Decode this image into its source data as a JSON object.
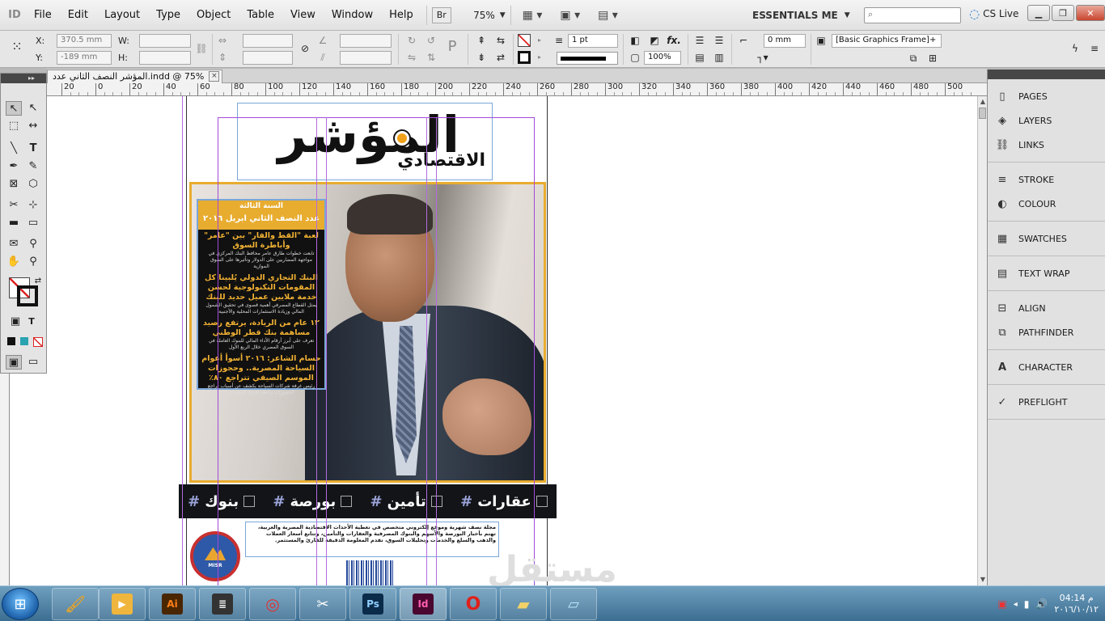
{
  "app": {
    "logo": "ID"
  },
  "menu": [
    "File",
    "Edit",
    "Layout",
    "Type",
    "Object",
    "Table",
    "View",
    "Window",
    "Help"
  ],
  "menubar": {
    "bridge": "Br",
    "zoom": "75%",
    "workspace": "ESSENTIALS ME",
    "cs_live": "CS Live"
  },
  "control": {
    "x_label": "X:",
    "x_value": "370.5 mm",
    "y_label": "Y:",
    "y_value": "-189 mm",
    "w_label": "W:",
    "h_label": "H:",
    "stroke_weight": "1 pt",
    "scale_percent": "100%",
    "offset_value": "0 mm",
    "object_style": "[Basic Graphics Frame]+"
  },
  "document": {
    "tab_title": "المؤشر النصف الثاني عدد.indd @ 75%",
    "tab_close": "×"
  },
  "ruler": {
    "labels": [
      "20",
      "0",
      "20",
      "40",
      "60",
      "80",
      "100",
      "120",
      "140",
      "160",
      "180",
      "200",
      "220",
      "240",
      "260",
      "280",
      "300",
      "320",
      "340",
      "360",
      "380",
      "400",
      "420",
      "440",
      "460",
      "480",
      "500"
    ]
  },
  "magazine": {
    "title_main": "المؤشر",
    "title_sub": "الاقتصادي",
    "issue_year": "السنة الثالثة",
    "issue_date": "عدد النصف الثاني ابريل ٢٠١٦",
    "stories": [
      {
        "title": "لعبة \"القط والفار\" بين \"عامر\" وأباطرة السوق",
        "body": "تابعت خطوات طارق عامر محافظ البنك المركزي في مواجهة المضاربين على الدولار وتأثيرها على السوق الموازية"
      },
      {
        "title": "البنك التجاري الدولي يُلبينا كل المقومات التكنولوجية لحسن خدمة ملايين عميل حديد للبنك",
        "body": "يمثل القطاع المصرفي أهمية قصوى في تحقيق الشمول المالي وزيادة الاستثمارات المحلية والأجنبية"
      },
      {
        "title": "١٢ عام من الريادة، يرتفع رصيد مساهمة بنك قطر الوطني",
        "body": "تعرف على أبرز أرقام الأداء المالي للبنوك العاملة في السوق المصري خلال الربع الأول"
      },
      {
        "title": "حسام الشاعر: ٢٠١٦ أسوأ أعوام السياحة المصرية.. وحجوزات الموسم الصيفي تتراجع ٨٠٪",
        "body": "رئيس غرفة شركات السياحة يكشف عن أسباب تراجع الحجوزات وخطة الإنقاذ المقترحة"
      }
    ],
    "hashtags": [
      "عقارات",
      "تأمين",
      "بورصة",
      "بنوك"
    ],
    "hash_symbol": "#",
    "about": "مجلة نصف شهرية وموقع إلكتروني متخصص في تغطية الأحداث الاقتصادية المصرية والعربية، تهتم بأخبار البورصة والأسهم والبنوك المصرفية والعقارات والتأمين، وتتابع أسعار العملات والذهب والسلع والخدمات وتحليلات السوق، تقدم المعلومة الدقيقة للقارئ والمستثمر.",
    "badge_label": "MISR"
  },
  "watermark": "مستقل",
  "tools_head": "▸▸",
  "right_panels": [
    {
      "group": 1,
      "items": [
        {
          "label": "PAGES",
          "icon": "pages-icon"
        },
        {
          "label": "LAYERS",
          "icon": "layers-icon"
        },
        {
          "label": "LINKS",
          "icon": "links-icon"
        }
      ]
    },
    {
      "group": 2,
      "items": [
        {
          "label": "STROKE",
          "icon": "stroke-icon"
        },
        {
          "label": "COLOUR",
          "icon": "colour-icon"
        }
      ]
    },
    {
      "group": 3,
      "items": [
        {
          "label": "SWATCHES",
          "icon": "swatches-icon"
        }
      ]
    },
    {
      "group": 4,
      "items": [
        {
          "label": "TEXT WRAP",
          "icon": "text-wrap-icon"
        }
      ]
    },
    {
      "group": 5,
      "items": [
        {
          "label": "ALIGN",
          "icon": "align-icon"
        },
        {
          "label": "PATHFINDER",
          "icon": "pathfinder-icon"
        }
      ]
    },
    {
      "group": 6,
      "items": [
        {
          "label": "CHARACTER",
          "icon": "character-icon"
        }
      ]
    },
    {
      "group": 7,
      "items": [
        {
          "label": "PREFLIGHT",
          "icon": "preflight-icon"
        }
      ]
    }
  ],
  "taskbar": {
    "apps": [
      {
        "name": "illustrator",
        "label": "Ai",
        "color": "#ff7f18",
        "bg": "#4a2600"
      },
      {
        "name": "photoshop",
        "label": "Ps",
        "color": "#8fd0ff",
        "bg": "#0b2b4a"
      },
      {
        "name": "indesign",
        "label": "Id",
        "color": "#ff5fb0",
        "bg": "#4a0830"
      }
    ],
    "clock_time": "04:14 م",
    "clock_date": "٢٠١٦/١٠/١٢"
  },
  "colors": {
    "accent_gold": "#e8ac2f",
    "frame_guide": "#a24ad8",
    "frame_blue": "#7aa6d8",
    "hashtag_bar": "#121418"
  }
}
